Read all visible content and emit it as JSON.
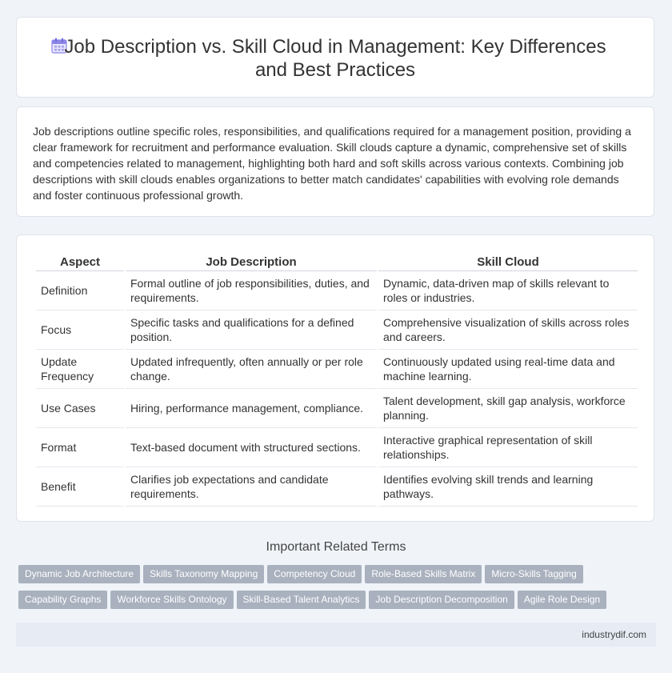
{
  "header": {
    "title": "Job Description vs. Skill Cloud in Management: Key Differences and Best Practices",
    "icon": "calendar-icon"
  },
  "intro": {
    "text": "Job descriptions outline specific roles, responsibilities, and qualifications required for a management position, providing a clear framework for recruitment and performance evaluation. Skill clouds capture a dynamic, comprehensive set of skills and competencies related to management, highlighting both hard and soft skills across various contexts. Combining job descriptions with skill clouds enables organizations to better match candidates' capabilities with evolving role demands and foster continuous professional growth."
  },
  "table": {
    "headers": [
      "Aspect",
      "Job Description",
      "Skill Cloud"
    ],
    "rows": [
      [
        "Definition",
        "Formal outline of job responsibilities, duties, and requirements.",
        "Dynamic, data-driven map of skills relevant to roles or industries."
      ],
      [
        "Focus",
        "Specific tasks and qualifications for a defined position.",
        "Comprehensive visualization of skills across roles and careers."
      ],
      [
        "Update Frequency",
        "Updated infrequently, often annually or per role change.",
        "Continuously updated using real-time data and machine learning."
      ],
      [
        "Use Cases",
        "Hiring, performance management, compliance.",
        "Talent development, skill gap analysis, workforce planning."
      ],
      [
        "Format",
        "Text-based document with structured sections.",
        "Interactive graphical representation of skill relationships."
      ],
      [
        "Benefit",
        "Clarifies job expectations and candidate requirements.",
        "Identifies evolving skill trends and learning pathways."
      ]
    ]
  },
  "related": {
    "title": "Important Related Terms",
    "tags": [
      "Dynamic Job Architecture",
      "Skills Taxonomy Mapping",
      "Competency Cloud",
      "Role-Based Skills Matrix",
      "Micro-Skills Tagging",
      "Capability Graphs",
      "Workforce Skills Ontology",
      "Skill-Based Talent Analytics",
      "Job Description Decomposition",
      "Agile Role Design"
    ]
  },
  "footer": {
    "text": "industrydif.com"
  },
  "colors": {
    "tag_bg": "#a9b1be",
    "page_bg": "#f0f3f8",
    "footer_bg": "#e6ebf4"
  }
}
